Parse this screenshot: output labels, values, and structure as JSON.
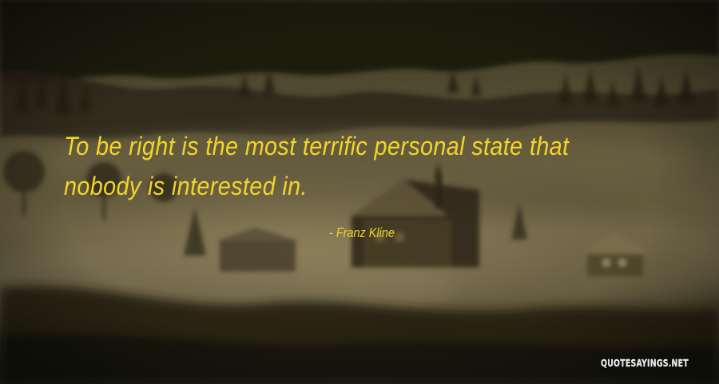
{
  "quote": {
    "line1": "To be right is the most terrific personal state that",
    "line2": "nobody is interested in."
  },
  "author": "- Franz Kline",
  "watermark": "QUOTESAYINGS.NET",
  "colors": {
    "quote_text": "#f2d52a",
    "fog": "#8a7d58",
    "hills": "#1c190e",
    "watermark": "#ffffff"
  },
  "background": {
    "icons": [
      "forest-hills",
      "fog",
      "farmhouse",
      "church-steeple",
      "tree-silhouettes"
    ]
  }
}
